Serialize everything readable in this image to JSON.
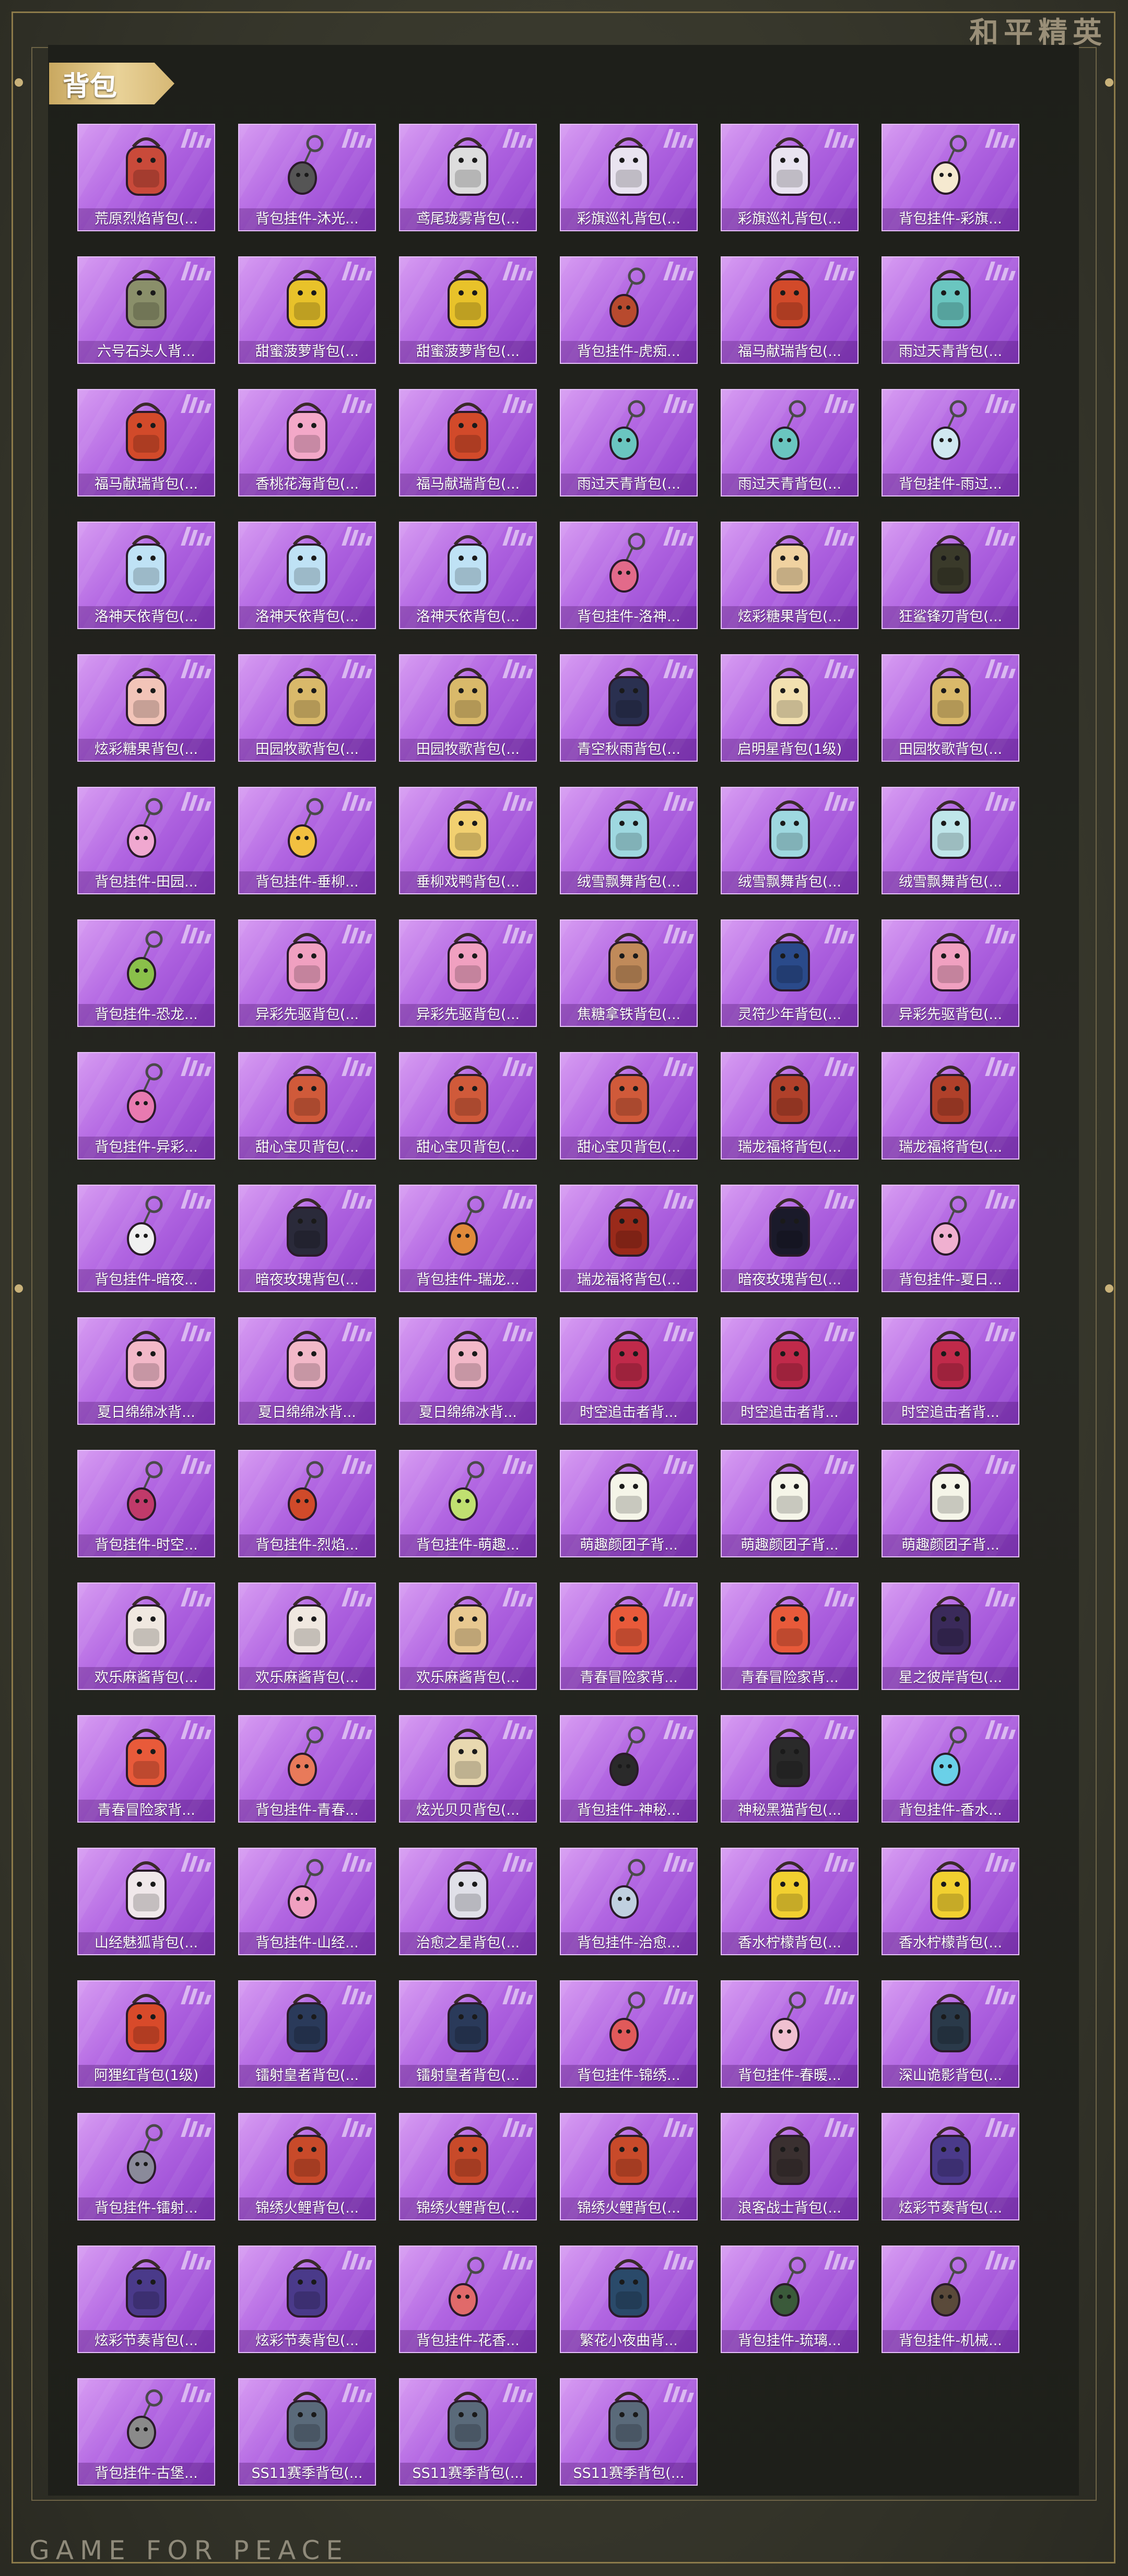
{
  "brand_top": "和平精英",
  "brand_bottom": "GAME FOR PEACE",
  "section_title": "背包",
  "colors": {
    "card_accent": "#b266e2",
    "frame_gold": "#c9a860",
    "panel_bg": "#1e1f1a"
  },
  "items": [
    {
      "label": "荒原烈焰背包(...",
      "icon": "backpack-icon",
      "color": "#c94a3a"
    },
    {
      "label": "背包挂件-沐光...",
      "icon": "charm-icon",
      "color": "#555555"
    },
    {
      "label": "鸢尾珑雾背包(...",
      "icon": "backpack-icon",
      "color": "#dddddd"
    },
    {
      "label": "彩旗巡礼背包(...",
      "icon": "backpack-icon",
      "color": "#e9e4f0"
    },
    {
      "label": "彩旗巡礼背包(...",
      "icon": "backpack-icon",
      "color": "#e9e4f0"
    },
    {
      "label": "背包挂件-彩旗...",
      "icon": "charm-icon",
      "color": "#f5e9d0"
    },
    {
      "label": "六号石头人背...",
      "icon": "backpack-icon",
      "color": "#8a8f6a"
    },
    {
      "label": "甜蜜菠萝背包(...",
      "icon": "backpack-icon",
      "color": "#e8c22a"
    },
    {
      "label": "甜蜜菠萝背包(...",
      "icon": "backpack-icon",
      "color": "#e8c22a"
    },
    {
      "label": "背包挂件-虎痴...",
      "icon": "charm-icon",
      "color": "#b84a2e"
    },
    {
      "label": "福马献瑞背包(...",
      "icon": "backpack-icon",
      "color": "#d24a2a"
    },
    {
      "label": "雨过天青背包(...",
      "icon": "backpack-icon",
      "color": "#6ac6c0"
    },
    {
      "label": "福马献瑞背包(...",
      "icon": "backpack-icon",
      "color": "#d24a2a"
    },
    {
      "label": "香桃花海背包(...",
      "icon": "backpack-icon",
      "color": "#f3a8c8"
    },
    {
      "label": "福马献瑞背包(...",
      "icon": "backpack-icon",
      "color": "#d24a2a"
    },
    {
      "label": "雨过天青背包(...",
      "icon": "charm-icon",
      "color": "#6ac6c0"
    },
    {
      "label": "雨过天青背包(...",
      "icon": "charm-icon",
      "color": "#6ac6c0"
    },
    {
      "label": "背包挂件-雨过...",
      "icon": "charm-icon",
      "color": "#d0e8f0"
    },
    {
      "label": "洛神天依背包(...",
      "icon": "backpack-icon",
      "color": "#bfe2f5"
    },
    {
      "label": "洛神天依背包(...",
      "icon": "backpack-icon",
      "color": "#bfe2f5"
    },
    {
      "label": "洛神天依背包(...",
      "icon": "backpack-icon",
      "color": "#bfe2f5"
    },
    {
      "label": "背包挂件-洛神...",
      "icon": "charm-icon",
      "color": "#e26a8a"
    },
    {
      "label": "炫彩糖果背包(...",
      "icon": "backpack-icon",
      "color": "#f0d2a0"
    },
    {
      "label": "狂鲨锋刃背包(...",
      "icon": "backpack-icon",
      "color": "#3a3a2a"
    },
    {
      "label": "炫彩糖果背包(...",
      "icon": "backpack-icon",
      "color": "#f2c4b8"
    },
    {
      "label": "田园牧歌背包(...",
      "icon": "backpack-icon",
      "color": "#d9b96a"
    },
    {
      "label": "田园牧歌背包(...",
      "icon": "backpack-icon",
      "color": "#d9b96a"
    },
    {
      "label": "青空秋雨背包(...",
      "icon": "backpack-icon",
      "color": "#2a3050"
    },
    {
      "label": "启明星背包(1级)",
      "icon": "backpack-icon",
      "color": "#f2e0b0"
    },
    {
      "label": "田园牧歌背包(...",
      "icon": "backpack-icon",
      "color": "#d9b96a"
    },
    {
      "label": "背包挂件-田园...",
      "icon": "charm-icon",
      "color": "#f0a8d0"
    },
    {
      "label": "背包挂件-垂柳...",
      "icon": "charm-icon",
      "color": "#f2c040"
    },
    {
      "label": "垂柳戏鸭背包(...",
      "icon": "backpack-icon",
      "color": "#f2d070"
    },
    {
      "label": "绒雪飘舞背包(...",
      "icon": "backpack-icon",
      "color": "#9ed8e0"
    },
    {
      "label": "绒雪飘舞背包(...",
      "icon": "backpack-icon",
      "color": "#9ed8e0"
    },
    {
      "label": "绒雪飘舞背包(...",
      "icon": "backpack-icon",
      "color": "#bfe6ea"
    },
    {
      "label": "背包挂件-恐龙...",
      "icon": "charm-icon",
      "color": "#8ac04a"
    },
    {
      "label": "异彩先驱背包(...",
      "icon": "backpack-icon",
      "color": "#f0a0c0"
    },
    {
      "label": "异彩先驱背包(...",
      "icon": "backpack-icon",
      "color": "#f0a0c0"
    },
    {
      "label": "焦糖拿铁背包(...",
      "icon": "backpack-icon",
      "color": "#c08a5a"
    },
    {
      "label": "灵符少年背包(...",
      "icon": "backpack-icon",
      "color": "#2a4a8a"
    },
    {
      "label": "异彩先驱背包(...",
      "icon": "backpack-icon",
      "color": "#f0a0c0"
    },
    {
      "label": "背包挂件-异彩...",
      "icon": "charm-icon",
      "color": "#e87ab0"
    },
    {
      "label": "甜心宝贝背包(...",
      "icon": "backpack-icon",
      "color": "#d05a3a"
    },
    {
      "label": "甜心宝贝背包(...",
      "icon": "backpack-icon",
      "color": "#d05a3a"
    },
    {
      "label": "甜心宝贝背包(...",
      "icon": "backpack-icon",
      "color": "#d05a3a"
    },
    {
      "label": "瑞龙福将背包(...",
      "icon": "backpack-icon",
      "color": "#b0402a"
    },
    {
      "label": "瑞龙福将背包(...",
      "icon": "backpack-icon",
      "color": "#b0402a"
    },
    {
      "label": "背包挂件-暗夜...",
      "icon": "charm-icon",
      "color": "#f0f0f0"
    },
    {
      "label": "暗夜玫瑰背包(...",
      "icon": "backpack-icon",
      "color": "#2a2a3a"
    },
    {
      "label": "背包挂件-瑞龙...",
      "icon": "charm-icon",
      "color": "#e08a3a"
    },
    {
      "label": "瑞龙福将背包(...",
      "icon": "backpack-icon",
      "color": "#9a2a1a"
    },
    {
      "label": "暗夜玫瑰背包(...",
      "icon": "backpack-icon",
      "color": "#1a1a2a"
    },
    {
      "label": "背包挂件-夏日...",
      "icon": "charm-icon",
      "color": "#f0b0d0"
    },
    {
      "label": "夏日绵绵冰背...",
      "icon": "backpack-icon",
      "color": "#f2b8c8"
    },
    {
      "label": "夏日绵绵冰背...",
      "icon": "backpack-icon",
      "color": "#f2b8c8"
    },
    {
      "label": "夏日绵绵冰背...",
      "icon": "backpack-icon",
      "color": "#f2b8c8"
    },
    {
      "label": "时空追击者背...",
      "icon": "backpack-icon",
      "color": "#c02a4a"
    },
    {
      "label": "时空追击者背...",
      "icon": "backpack-icon",
      "color": "#c02a4a"
    },
    {
      "label": "时空追击者背...",
      "icon": "backpack-icon",
      "color": "#c02a4a"
    },
    {
      "label": "背包挂件-时空...",
      "icon": "charm-icon",
      "color": "#c03a6a"
    },
    {
      "label": "背包挂件-烈焰...",
      "icon": "charm-icon",
      "color": "#d04a2a"
    },
    {
      "label": "背包挂件-萌趣...",
      "icon": "charm-icon",
      "color": "#c0e070"
    },
    {
      "label": "萌趣颜团子背...",
      "icon": "backpack-icon",
      "color": "#f5f5e8"
    },
    {
      "label": "萌趣颜团子背...",
      "icon": "backpack-icon",
      "color": "#f5f5e8"
    },
    {
      "label": "萌趣颜团子背...",
      "icon": "backpack-icon",
      "color": "#f5f5e8"
    },
    {
      "label": "欢乐麻酱背包(...",
      "icon": "backpack-icon",
      "color": "#f0e8e0"
    },
    {
      "label": "欢乐麻酱背包(...",
      "icon": "backpack-icon",
      "color": "#f0e8e0"
    },
    {
      "label": "欢乐麻酱背包(...",
      "icon": "backpack-icon",
      "color": "#e8c890"
    },
    {
      "label": "青春冒险家背...",
      "icon": "backpack-icon",
      "color": "#e85a3a"
    },
    {
      "label": "青春冒险家背...",
      "icon": "backpack-icon",
      "color": "#e85a3a"
    },
    {
      "label": "星之彼岸背包(...",
      "icon": "backpack-icon",
      "color": "#3a2a5a"
    },
    {
      "label": "青春冒险家背...",
      "icon": "backpack-icon",
      "color": "#e85a3a"
    },
    {
      "label": "背包挂件-青春...",
      "icon": "charm-icon",
      "color": "#e87a5a"
    },
    {
      "label": "炫光贝贝背包(...",
      "icon": "backpack-icon",
      "color": "#e8d8b0"
    },
    {
      "label": "背包挂件-神秘...",
      "icon": "charm-icon",
      "color": "#2a2a2a"
    },
    {
      "label": "神秘黑猫背包(...",
      "icon": "backpack-icon",
      "color": "#2a2a2a"
    },
    {
      "label": "背包挂件-香水...",
      "icon": "charm-icon",
      "color": "#6ad0e8"
    },
    {
      "label": "山经魅狐背包(...",
      "icon": "backpack-icon",
      "color": "#f0e8ea"
    },
    {
      "label": "背包挂件-山经...",
      "icon": "charm-icon",
      "color": "#f0a0c0"
    },
    {
      "label": "治愈之星背包(...",
      "icon": "backpack-icon",
      "color": "#e0e0e8"
    },
    {
      "label": "背包挂件-治愈...",
      "icon": "charm-icon",
      "color": "#c0d0e0"
    },
    {
      "label": "香水柠檬背包(...",
      "icon": "backpack-icon",
      "color": "#f2d030"
    },
    {
      "label": "香水柠檬背包(...",
      "icon": "backpack-icon",
      "color": "#f2d030"
    },
    {
      "label": "阿狸红背包(1级)",
      "icon": "backpack-icon",
      "color": "#d84a2a"
    },
    {
      "label": "镭射皇者背包(...",
      "icon": "backpack-icon",
      "color": "#2a3a5a"
    },
    {
      "label": "镭射皇者背包(...",
      "icon": "backpack-icon",
      "color": "#2a3a5a"
    },
    {
      "label": "背包挂件-锦绣...",
      "icon": "charm-icon",
      "color": "#e05a5a"
    },
    {
      "label": "背包挂件-春暖...",
      "icon": "charm-icon",
      "color": "#f0c0d0"
    },
    {
      "label": "深山诡影背包(...",
      "icon": "backpack-icon",
      "color": "#2a3a4a"
    },
    {
      "label": "背包挂件-镭射...",
      "icon": "charm-icon",
      "color": "#8a8a9a"
    },
    {
      "label": "锦绣火鲤背包(...",
      "icon": "backpack-icon",
      "color": "#c84a2a"
    },
    {
      "label": "锦绣火鲤背包(...",
      "icon": "backpack-icon",
      "color": "#c84a2a"
    },
    {
      "label": "锦绣火鲤背包(...",
      "icon": "backpack-icon",
      "color": "#c84a2a"
    },
    {
      "label": "浪客战士背包(...",
      "icon": "backpack-icon",
      "color": "#3a3030"
    },
    {
      "label": "炫彩节奏背包(...",
      "icon": "backpack-icon",
      "color": "#4a3a8a"
    },
    {
      "label": "炫彩节奏背包(...",
      "icon": "backpack-icon",
      "color": "#4a3a8a"
    },
    {
      "label": "炫彩节奏背包(...",
      "icon": "backpack-icon",
      "color": "#4a3a8a"
    },
    {
      "label": "背包挂件-花香...",
      "icon": "charm-icon",
      "color": "#e06a6a"
    },
    {
      "label": "繁花小夜曲背...",
      "icon": "backpack-icon",
      "color": "#2a4a6a"
    },
    {
      "label": "背包挂件-琉璃...",
      "icon": "charm-icon",
      "color": "#3a5a3a"
    },
    {
      "label": "背包挂件-机械...",
      "icon": "charm-icon",
      "color": "#5a4a3a"
    },
    {
      "label": "背包挂件-古堡...",
      "icon": "charm-icon",
      "color": "#8a8a8a"
    },
    {
      "label": "SS11赛季背包(...",
      "icon": "backpack-icon",
      "color": "#5a6a7a"
    },
    {
      "label": "SS11赛季背包(...",
      "icon": "backpack-icon",
      "color": "#5a6a7a"
    },
    {
      "label": "SS11赛季背包(...",
      "icon": "backpack-icon",
      "color": "#5a6a7a"
    }
  ]
}
